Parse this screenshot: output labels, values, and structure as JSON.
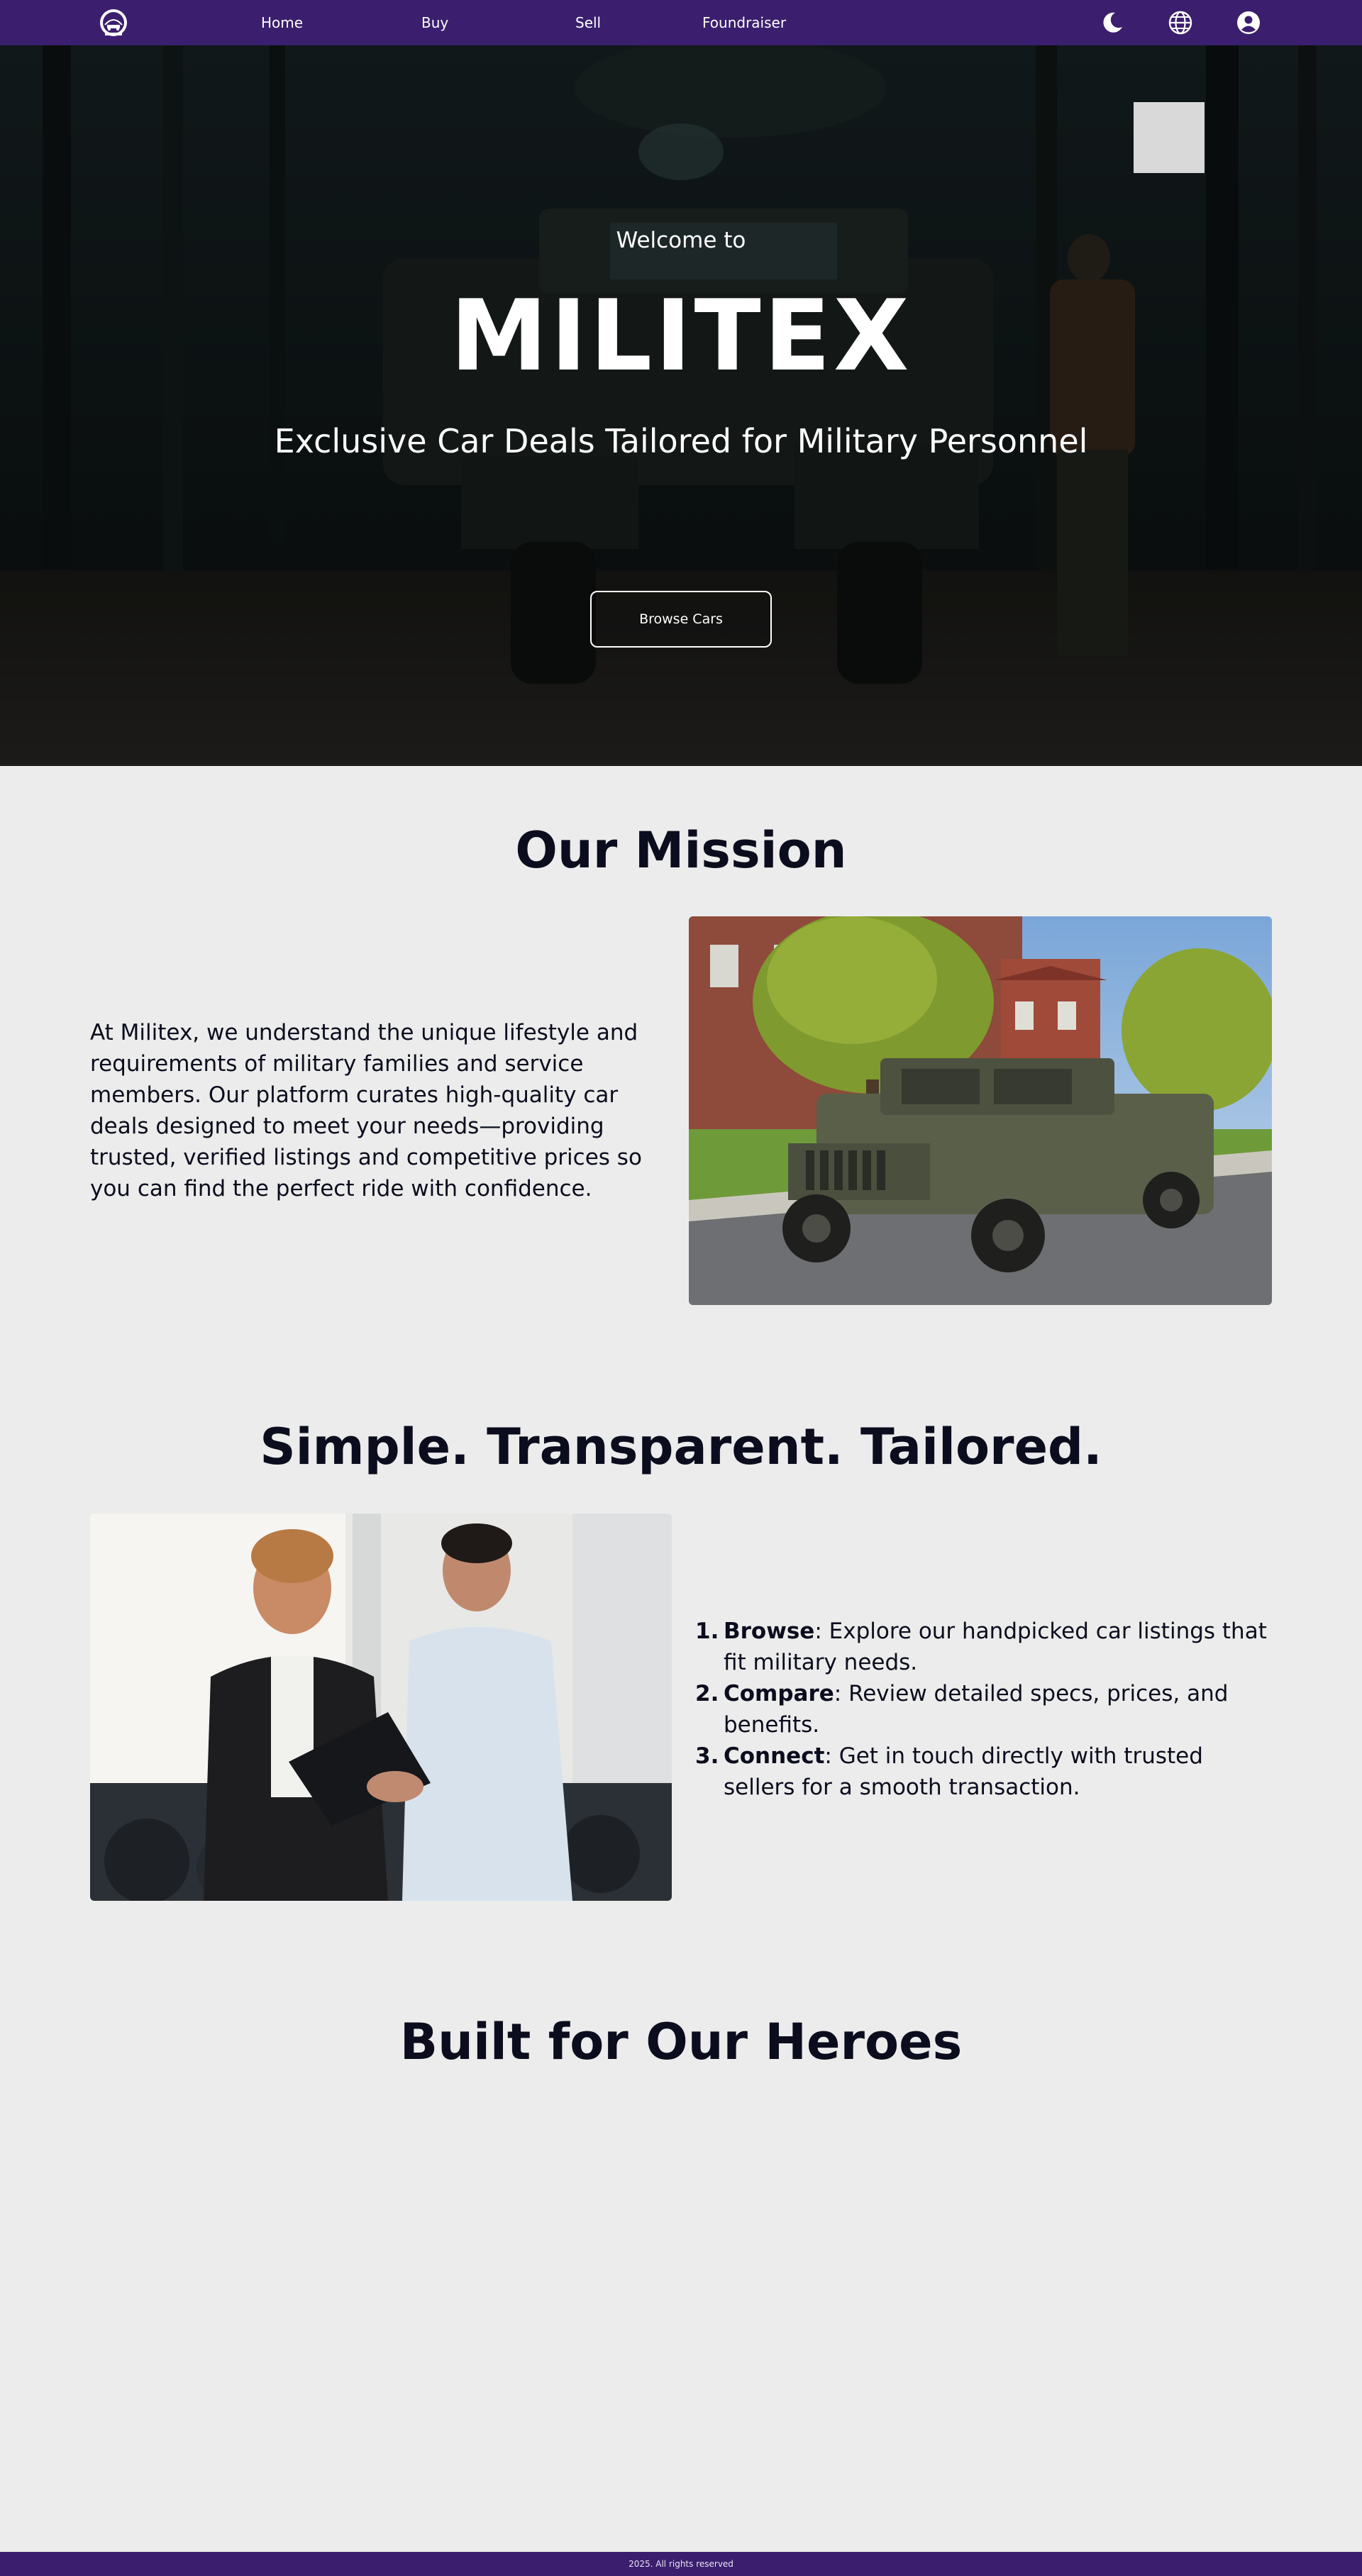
{
  "nav": {
    "logo_icon": "militex-logo-icon",
    "links": [
      {
        "label": "Home"
      },
      {
        "label": "Buy"
      },
      {
        "label": "Sell"
      },
      {
        "label": "Foundraiser"
      }
    ],
    "icons": [
      "moon-icon",
      "globe-icon",
      "user-icon"
    ],
    "background_color": "#3b1f6e"
  },
  "hero": {
    "welcome": "Welcome to",
    "title": "MILITEX",
    "subtitle": "Exclusive Car Deals Tailored for Military Personnel",
    "button_label": "Browse Cars"
  },
  "mission": {
    "heading": "Our Mission",
    "text": "At Militex, we understand the unique lifestyle and requirements of military families and service members. Our platform curates high-quality car deals designed to meet your needs—providing trusted, verified listings and competitive prices so you can find the perfect ride with confidence."
  },
  "simple": {
    "heading": "Simple. Transparent. Tailored.",
    "steps": [
      {
        "num": "1.",
        "title": "Browse",
        "text": ": Explore our handpicked car listings that fit military needs."
      },
      {
        "num": "2.",
        "title": "Compare",
        "text": ": Review detailed specs, prices, and benefits."
      },
      {
        "num": "3.",
        "title": "Connect",
        "text": ": Get in touch directly with trusted sellers for a smooth transaction."
      }
    ]
  },
  "heroes": {
    "heading": "Built for Our Heroes"
  },
  "footer": {
    "text": "2025. All rights reserved"
  }
}
